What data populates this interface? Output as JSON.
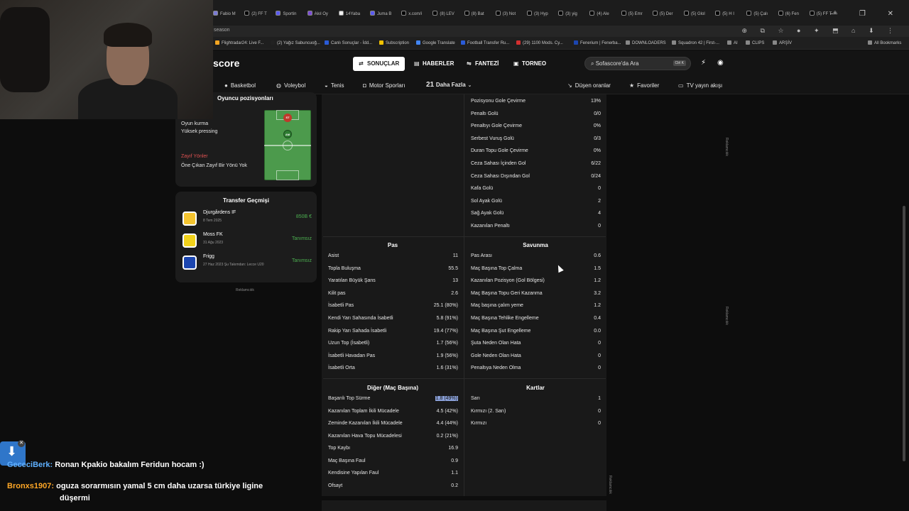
{
  "browser": {
    "tabs": [
      {
        "label": "Fabio M",
        "color": "#7b7bd6"
      },
      {
        "label": "(2) FF T",
        "color": "#000000"
      },
      {
        "label": "Sportin",
        "color": "#5a5af0"
      },
      {
        "label": "Akıl Oy",
        "color": "#7b4bd6"
      },
      {
        "label": "14Yaba",
        "color": "#f0f0f0"
      },
      {
        "label": "Juma B",
        "color": "#5a5af0"
      },
      {
        "label": "x.com/i",
        "color": "#000000"
      },
      {
        "label": "(8) LEV",
        "color": "#000000"
      },
      {
        "label": "(8) Bat",
        "color": "#000000"
      },
      {
        "label": "(3) Not",
        "color": "#000000"
      },
      {
        "label": "(3) Hyp",
        "color": "#000000"
      },
      {
        "label": "(3) yig",
        "color": "#000000"
      },
      {
        "label": "(4) Ale",
        "color": "#000000"
      },
      {
        "label": "(5) Emr",
        "color": "#000000"
      },
      {
        "label": "(5) Der",
        "color": "#000000"
      },
      {
        "label": "(5) Glol",
        "color": "#000000"
      },
      {
        "label": "(5) H I",
        "color": "#000000"
      },
      {
        "label": "(5) Çalı",
        "color": "#000000"
      },
      {
        "label": "(6) Fen",
        "color": "#000000"
      },
      {
        "label": "(5) FF T",
        "color": "#000000"
      }
    ],
    "url": "season",
    "bookmarks": [
      "Flightradar24: Live F...",
      "(2) Yağız Sabuncuoğ...",
      "Canlı Sonuçlar - İdd...",
      "Subscription",
      "Google Translate",
      "Football Transfer Ru...",
      "(29) 1100 Mods. Cy...",
      "Fenerium | Fenerba...",
      "DOWNLOADERS",
      "Squadron 42 | First-...",
      "AI",
      "CLIPS",
      "ARŞİV",
      "All Bookmarks"
    ]
  },
  "site": {
    "logo": "score",
    "nav": [
      {
        "label": "SONUÇLAR",
        "icon": "scores-icon",
        "active": true
      },
      {
        "label": "HABERLER",
        "icon": "news-icon",
        "active": false
      },
      {
        "label": "FANTEZİ",
        "icon": "fantasy-icon",
        "active": false
      },
      {
        "label": "TORNEO",
        "icon": "torneo-icon",
        "active": false
      }
    ],
    "search_placeholder": "Sofascore'da Ara",
    "search_kbd": "Ctrl K",
    "subnav": [
      {
        "label": "Basketbol",
        "icon": "basketball-icon"
      },
      {
        "label": "Voleybol",
        "icon": "volleyball-icon"
      },
      {
        "label": "Tenis",
        "icon": "tennis-icon"
      },
      {
        "label": "Motor Sporları",
        "icon": "car-icon"
      },
      {
        "label": "Daha Fazla",
        "prefix": "21"
      },
      {
        "label": "Düşen oranlar",
        "icon": "trend-icon"
      },
      {
        "label": "Favoriler",
        "icon": "star-icon"
      },
      {
        "label": "TV yayın akışı",
        "icon": "tv-icon"
      }
    ]
  },
  "positions": {
    "title": "Oyuncu pozisyonları",
    "strengths": [
      "Oyun kurma",
      "Yüksek pressing"
    ],
    "weak_title": "Zayıf Yönler",
    "weak_text": "Öne Çıkan Zayıf Bir Yönü Yok",
    "pitch_labels": [
      "ST",
      "AM"
    ]
  },
  "transfers": {
    "title": "Transfer Geçmişi",
    "rows": [
      {
        "club": "Djurgårdens IF",
        "date": "8 Tem 2025",
        "fee": "850B €",
        "color": "#f4c430"
      },
      {
        "club": "Moss FK",
        "date": "31 Ağu 2023",
        "fee": "Tanımsız",
        "color": "#f2d21b"
      },
      {
        "club": "Frigg",
        "date": "27 Haz 2023 Şu Takımdan: Lecce U20",
        "fee": "Tanımsız",
        "color": "#1c46b0"
      }
    ],
    "ad": "Reklamcılık"
  },
  "stats": {
    "shooting": [
      {
        "label": "Pozisyonu Gole Çevirme",
        "value": "13%"
      },
      {
        "label": "Penaltı Golü",
        "value": "0/0"
      },
      {
        "label": "Penaltıyı Gole Çevirme",
        "value": "0%"
      },
      {
        "label": "Serbest Vuruş Golü",
        "value": "0/3"
      },
      {
        "label": "Duran Topu Gole Çevirme",
        "value": "0%"
      },
      {
        "label": "Ceza Sahası İçinden Gol",
        "value": "6/22"
      },
      {
        "label": "Ceza Sahası Dışından Gol",
        "value": "0/24"
      },
      {
        "label": "Kafa Golü",
        "value": "0"
      },
      {
        "label": "Sol Ayak Golü",
        "value": "2"
      },
      {
        "label": "Sağ Ayak Golü",
        "value": "4"
      },
      {
        "label": "Kazanılan Penaltı",
        "value": "0"
      }
    ],
    "passing_title": "Pas",
    "passing": [
      {
        "label": "Asist",
        "value": "11"
      },
      {
        "label": "Topla Buluşma",
        "value": "55.5"
      },
      {
        "label": "Yaratılan Büyük Şans",
        "value": "13"
      },
      {
        "label": "Kilit pas",
        "value": "2.6"
      },
      {
        "label": "İsabetli Pas",
        "value": "25.1 (80%)"
      },
      {
        "label": "Kendi Yarı Sahasında İsabetli",
        "value": "5.8 (91%)"
      },
      {
        "label": "Rakip Yarı Sahada İsabetli",
        "value": "19.4 (77%)"
      },
      {
        "label": "Uzun Top (İsabetli)",
        "value": "1.7 (56%)"
      },
      {
        "label": "İsabetli Havadan Pas",
        "value": "1.9 (56%)"
      },
      {
        "label": "İsabetli Orta",
        "value": "1.6 (31%)"
      }
    ],
    "defense_title": "Savunma",
    "defense": [
      {
        "label": "Pas Arası",
        "value": "0.6"
      },
      {
        "label": "Maç Başına Top Çalma",
        "value": "1.5"
      },
      {
        "label": "Kazanılan Pozisyon (Gol Bölgesi)",
        "value": "1.2"
      },
      {
        "label": "Maç Başına Topu Geri Kazanma",
        "value": "3.2"
      },
      {
        "label": "Maç başına çalım yeme",
        "value": "1.2"
      },
      {
        "label": "Maç Başına Tehlike Engelleme",
        "value": "0.4"
      },
      {
        "label": "Maç Başına Şut Engelleme",
        "value": "0.0"
      },
      {
        "label": "Şuta Neden Olan Hata",
        "value": "0"
      },
      {
        "label": "Gole Neden Olan Hata",
        "value": "0"
      },
      {
        "label": "Penaltıya Neden Olma",
        "value": "0"
      }
    ],
    "other_title": "Diğer (Maç Başına)",
    "other": [
      {
        "label": "Başarılı Top Sürme",
        "value": "1.8 (49%)",
        "highlight": true
      },
      {
        "label": "Kazanılan Toplam İkili Mücadele",
        "value": "4.5 (42%)"
      },
      {
        "label": "Zeminde Kazanılan İkili Mücadele",
        "value": "4.4 (44%)"
      },
      {
        "label": "Kazanılan Hava Topu Mücadelesi",
        "value": "0.2 (21%)"
      },
      {
        "label": "Top Kaybı",
        "value": "16.9"
      },
      {
        "label": "Maç Başına Faul",
        "value": "0.9"
      },
      {
        "label": "Kendisine Yapılan Faul",
        "value": "1.1"
      },
      {
        "label": "Ofsayt",
        "value": "0.2"
      }
    ],
    "cards_title": "Kartlar",
    "cards": [
      {
        "label": "Sarı",
        "value": "1"
      },
      {
        "label": "Kırmızı (2. Sarı)",
        "value": "0"
      },
      {
        "label": "Kırmızı",
        "value": "0"
      }
    ]
  },
  "ad_label": "Reklamcılık",
  "chat": [
    {
      "user": "GececiBerk:",
      "message": "Ronan Kpakio bakalım Feridun hocam :)"
    },
    {
      "user": "Bronxs1907:",
      "message": "oguza sorarmısın yamal 5 cm daha uzarsa türkiye ligine",
      "message2": "düşermi"
    }
  ]
}
